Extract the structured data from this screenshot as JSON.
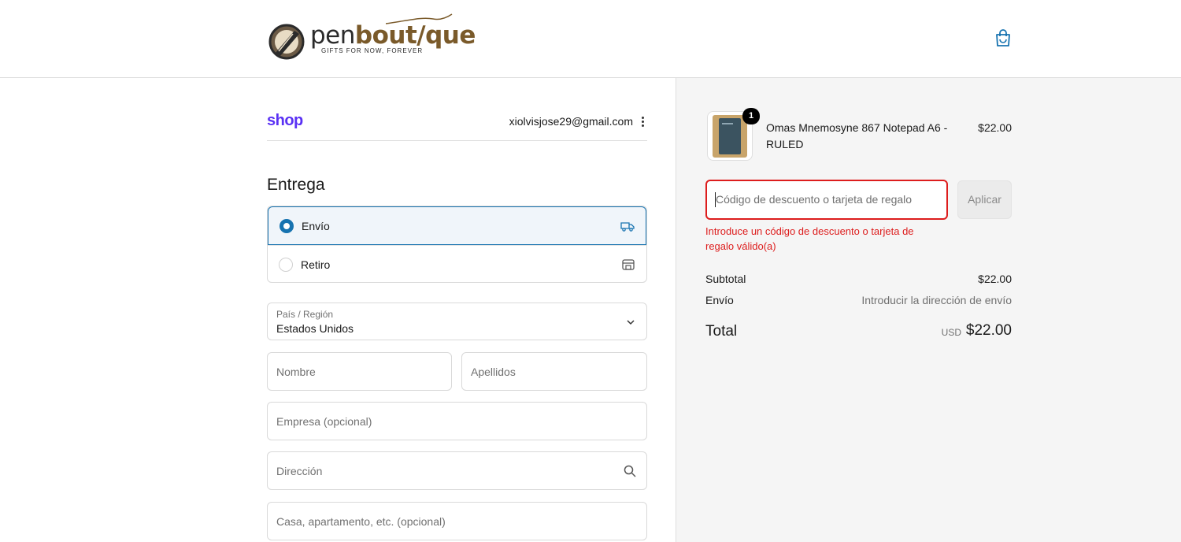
{
  "brand": {
    "logo_pen": "pen",
    "logo_boutique": "bout/que",
    "tagline": "GIFTS FOR NOW, FOREVER",
    "color_gold": "#7a5a2a"
  },
  "header": {
    "cart_icon": "shopping-bag-icon"
  },
  "account": {
    "shop_label": "shop",
    "email": "xiolvisjose29@gmail.com",
    "menu_icon": "kebab-menu-icon"
  },
  "delivery": {
    "title": "Entrega",
    "options": [
      {
        "label": "Envío",
        "icon": "truck-icon",
        "selected": true
      },
      {
        "label": "Retiro",
        "icon": "store-icon",
        "selected": false
      }
    ]
  },
  "form": {
    "country_label": "País / Región",
    "country_value": "Estados Unidos",
    "first_name_placeholder": "Nombre",
    "last_name_placeholder": "Apellidos",
    "company_placeholder": "Empresa (opcional)",
    "address_placeholder": "Dirección",
    "apartment_placeholder": "Casa, apartamento, etc. (opcional)"
  },
  "summary": {
    "item": {
      "name": "Omas Mnemosyne 867 Notepad A6 - RULED",
      "price": "$22.00",
      "quantity": "1"
    },
    "discount_placeholder": "Código de descuento o tarjeta de regalo",
    "apply_label": "Aplicar",
    "error": "Introduce un código de descuento o tarjeta de regalo válido(a)",
    "subtotal_label": "Subtotal",
    "subtotal_value": "$22.00",
    "shipping_label": "Envío",
    "shipping_value": "Introducir la dirección de envío",
    "total_label": "Total",
    "currency": "USD",
    "total_value": "$22.00"
  },
  "colors": {
    "accent": "#1773b0",
    "shop_purple": "#5a31f4",
    "error": "#dd1d1d"
  }
}
